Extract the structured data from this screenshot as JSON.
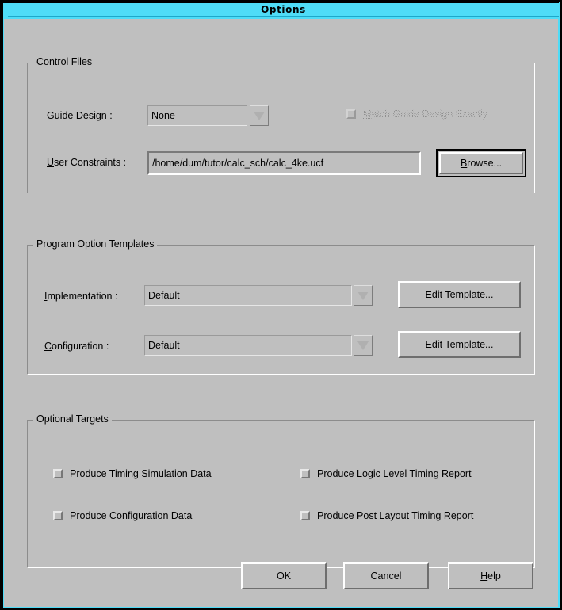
{
  "window": {
    "title": "Options",
    "titlebar_color": "#4fdcf7",
    "background_color": "#bfbfbf"
  },
  "control_files": {
    "group_title": "Control Files",
    "guide_design": {
      "label_pre": "G",
      "label_post": "uide Design :",
      "value": "None",
      "arrow_icon": "chevron-down-icon"
    },
    "match_guide": {
      "label_pre": "M",
      "label_post": "atch Guide Design Exactly",
      "checked": false,
      "enabled": false
    },
    "user_constraints": {
      "label_pre": "U",
      "label_post": "ser Constraints :",
      "value": "/home/dum/tutor/calc_sch/calc_4ke.ucf"
    },
    "browse_button": {
      "label_pre": "B",
      "label_post": "rowse...",
      "is_default": true
    }
  },
  "program_option_templates": {
    "group_title": "Program Option Templates",
    "implementation": {
      "label_pre": "I",
      "label_post": "mplementation :",
      "value": "Default",
      "arrow_icon": "chevron-down-icon",
      "edit_button_pre": "E",
      "edit_button_post": "dit Template..."
    },
    "configuration": {
      "label_pre": "C",
      "label_post": "onfiguration :",
      "value": "Default",
      "arrow_icon": "chevron-down-icon",
      "edit_button_a": "E",
      "edit_button_b": "d",
      "edit_button_c": "it Template..."
    }
  },
  "optional_targets": {
    "group_title": "Optional Targets",
    "items": [
      {
        "pre": "Produce Timing ",
        "mnemonic": "S",
        "post": "imulation Data",
        "checked": false
      },
      {
        "pre": "Produce ",
        "mnemonic": "L",
        "post": "ogic Level Timing Report",
        "checked": false
      },
      {
        "pre": "Produce Con",
        "mnemonic": "f",
        "post": "iguration Data",
        "checked": false
      },
      {
        "pre": "",
        "mnemonic": "P",
        "post": "roduce Post Layout Timing Report",
        "checked": false
      }
    ]
  },
  "footer": {
    "ok_label": "OK",
    "cancel_label": "Cancel",
    "help_pre": "H",
    "help_post": "elp"
  }
}
